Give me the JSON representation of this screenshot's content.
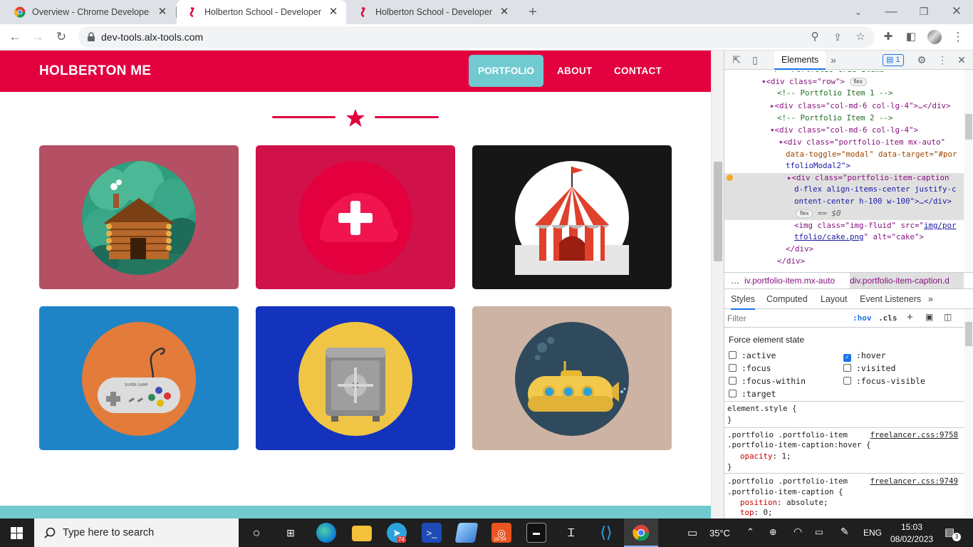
{
  "tabs": [
    {
      "title": "Overview - Chrome Developers",
      "active": false
    },
    {
      "title": "Holberton School - Developer to",
      "active": true
    },
    {
      "title": "Holberton School - Developer to",
      "active": false
    }
  ],
  "toolbar": {
    "url": "dev-tools.alx-tools.com"
  },
  "page": {
    "brand": "HOLBERTON ME",
    "nav": {
      "portfolio": "PORTFOLIO",
      "about": "ABOUT",
      "contact": "CONTACT"
    },
    "cards": [
      {
        "icon": "cabin-icon",
        "bg": "#b54f63"
      },
      {
        "icon": "cake-icon",
        "bg": "#d0114a"
      },
      {
        "icon": "circus-icon",
        "bg": "#161616"
      },
      {
        "icon": "game-controller-icon",
        "bg": "#1f84c6"
      },
      {
        "icon": "safe-icon",
        "bg": "#1433bd"
      },
      {
        "icon": "submarine-icon",
        "bg": "#cdb3a3"
      }
    ],
    "controller_label": "SUPER GAMP"
  },
  "devtools": {
    "elements_tab": "Elements",
    "issues_count": "1",
    "lines": [
      "<!-- Portfolio Grid Items -->",
      "<div class=\"row\">",
      "<!-- Portfolio Item 1 -->",
      "<div class=\"col-md-6 col-lg-4\">…</div>",
      "<!-- Portfolio Item 2 -->",
      "<div class=\"col-md-6 col-lg-4\">",
      "<div class=\"portfolio-item mx-auto\"",
      "data-toggle=\"modal\" data-target=\"#por",
      "tfolioModal2\">",
      "<div class=\"portfolio-item-caption",
      "d-flex align-items-center justify-c",
      "ontent-center h-100 w-100\">…</div>",
      "== $0",
      "<img class=\"img-fluid\" src=\"",
      "img/por",
      "tfolio/cake.png",
      "\" alt=\"cake\">",
      "</div>",
      "</div>"
    ],
    "flex_badge": "flex",
    "breadcrumbs": [
      "…",
      "iv.portfolio-item.mx-auto",
      "div.portfolio-item-caption.d"
    ],
    "subtabs": [
      "Styles",
      "Computed",
      "Layout",
      "Event Listeners"
    ],
    "filter_placeholder": "Filter",
    "hov": ":hov",
    "cls": ".cls",
    "force_state_title": "Force element state",
    "states": [
      {
        "label": ":active",
        "checked": false
      },
      {
        "label": ":hover",
        "checked": true
      },
      {
        "label": ":focus",
        "checked": false
      },
      {
        "label": ":visited",
        "checked": false
      },
      {
        "label": ":focus-within",
        "checked": false
      },
      {
        "label": ":focus-visible",
        "checked": false
      },
      {
        "label": ":target",
        "checked": false
      }
    ],
    "rules": [
      {
        "selector": "element.style {",
        "end": "}"
      },
      {
        "selector": ".portfolio .portfolio-item",
        "selector2": ".portfolio-item-caption:hover {",
        "source": "freelancer.css:9758",
        "prop": "opacity",
        "val": "1;",
        "end": "}"
      },
      {
        "selector": ".portfolio .portfolio-item",
        "selector2": ".portfolio-item-caption {",
        "source": "freelancer.css:9749",
        "prop": "position",
        "val": "absolute;",
        "prop2": "top",
        "val2": "0;"
      }
    ]
  },
  "taskbar": {
    "search_placeholder": "Type here to search",
    "telegram_badge": "74",
    "app_badge": "18.04",
    "weather": "35°C",
    "lang": "ENG",
    "time": "15:03",
    "date": "08/02/2023",
    "notifications": "3"
  }
}
